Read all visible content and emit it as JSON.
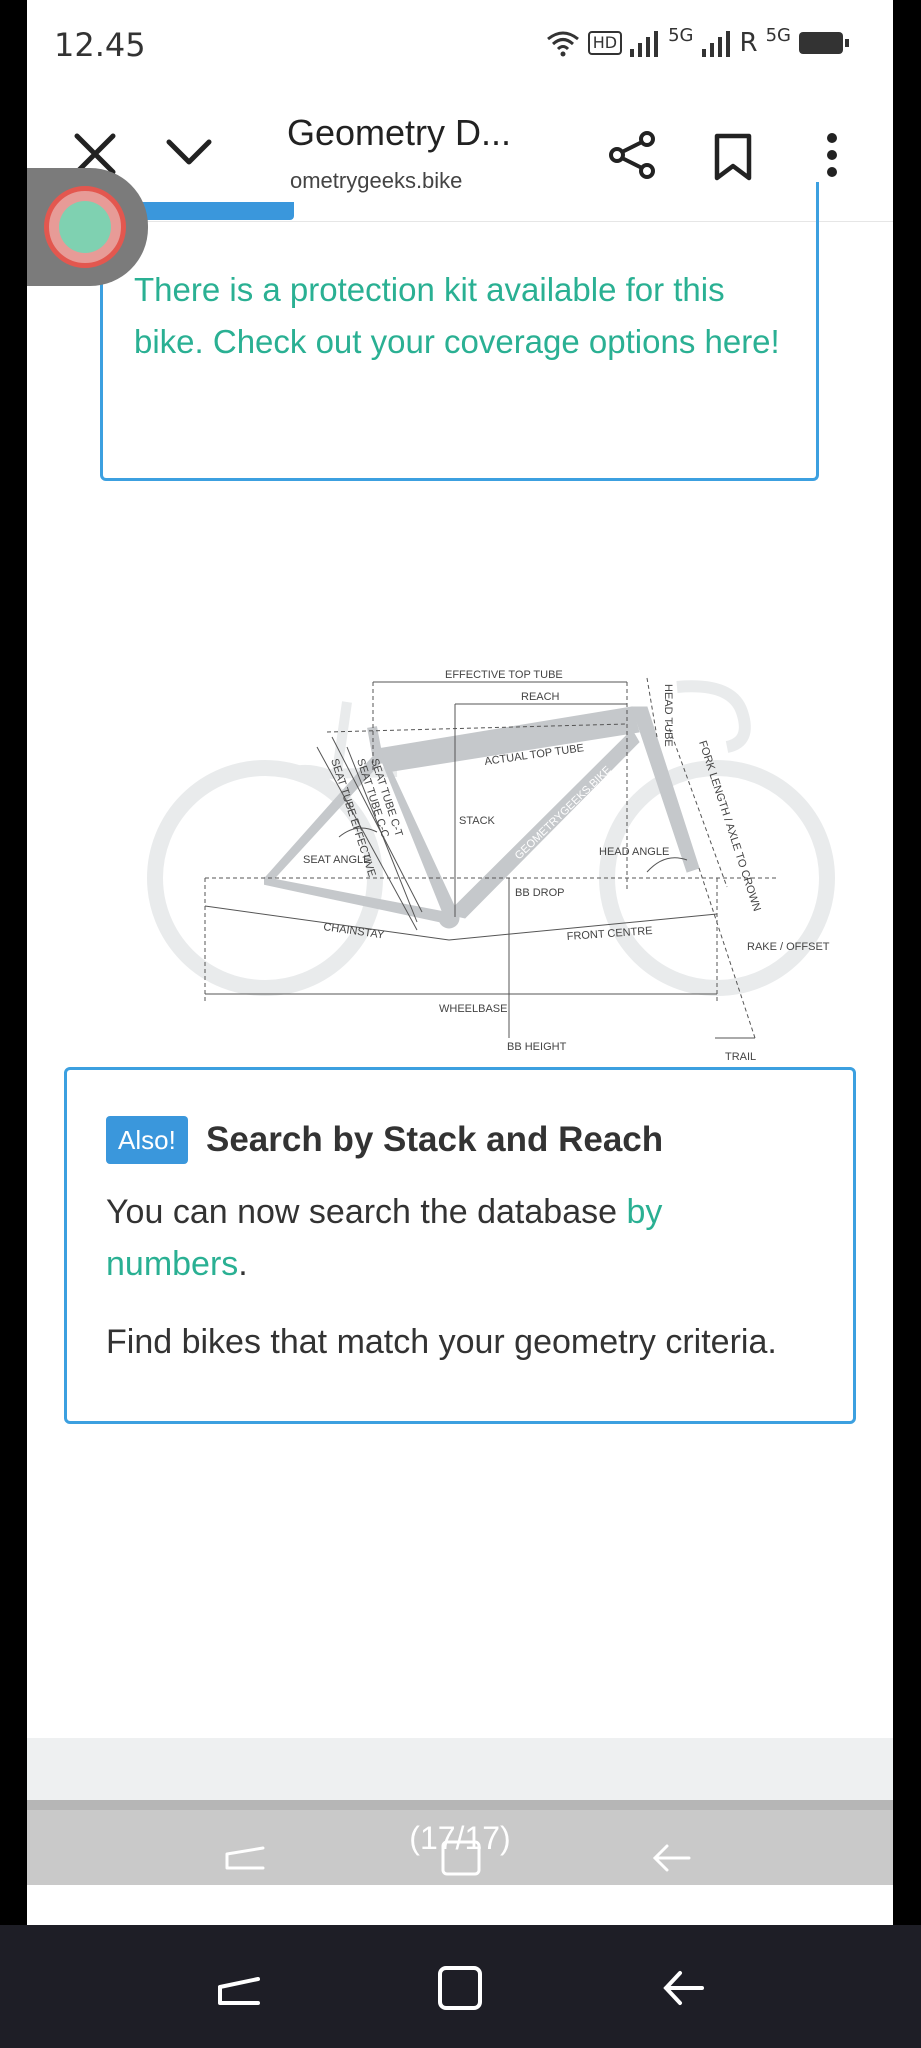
{
  "status_bar": {
    "time": "12.45",
    "hd": "HD",
    "sim1_network": "5G",
    "roaming": "R",
    "sim2_network": "5G"
  },
  "toolbar": {
    "title": "Geometry D...",
    "url": "ometrygeeks.bike"
  },
  "protection": {
    "text": "There is a protection kit available for this bike. Check out your coverage options here!"
  },
  "diagram": {
    "labels": {
      "effective_top_tube": "EFFECTIVE TOP TUBE",
      "reach": "REACH",
      "actual_top_tube": "ACTUAL TOP TUBE",
      "head_tube": "HEAD TUBE",
      "fork_length": "FORK LENGTH / AXLE TO CROWN",
      "stack": "STACK",
      "seat_tube_ct": "SEAT TUBE C-T",
      "seat_tube_cc": "SEAT TUBE C-C",
      "seat_tube_effective": "SEAT TUBE EFFECTIVE",
      "seat_angle": "SEAT ANGLE",
      "head_angle": "HEAD ANGLE",
      "bb_drop": "BB DROP",
      "chainstay": "CHAINSTAY",
      "front_centre": "FRONT CENTRE",
      "rake_offset": "RAKE / OFFSET",
      "wheelbase": "WHEELBASE",
      "bb_height": "BB HEIGHT",
      "trail": "TRAIL",
      "watermark": "GEOMETRYGEEKS.BIKE"
    }
  },
  "also": {
    "badge": "Also!",
    "title": "Search by Stack and Reach",
    "text_prefix": "You can now search the database ",
    "link": "by numbers",
    "text_suffix": ".",
    "text2": "Find bikes that match your geometry criteria."
  },
  "overlay": {
    "counter": "(17/17)"
  },
  "colors": {
    "accent_blue": "#3a97dc",
    "accent_green": "#2ab093",
    "diagram_grey": "#c5c8cb"
  }
}
